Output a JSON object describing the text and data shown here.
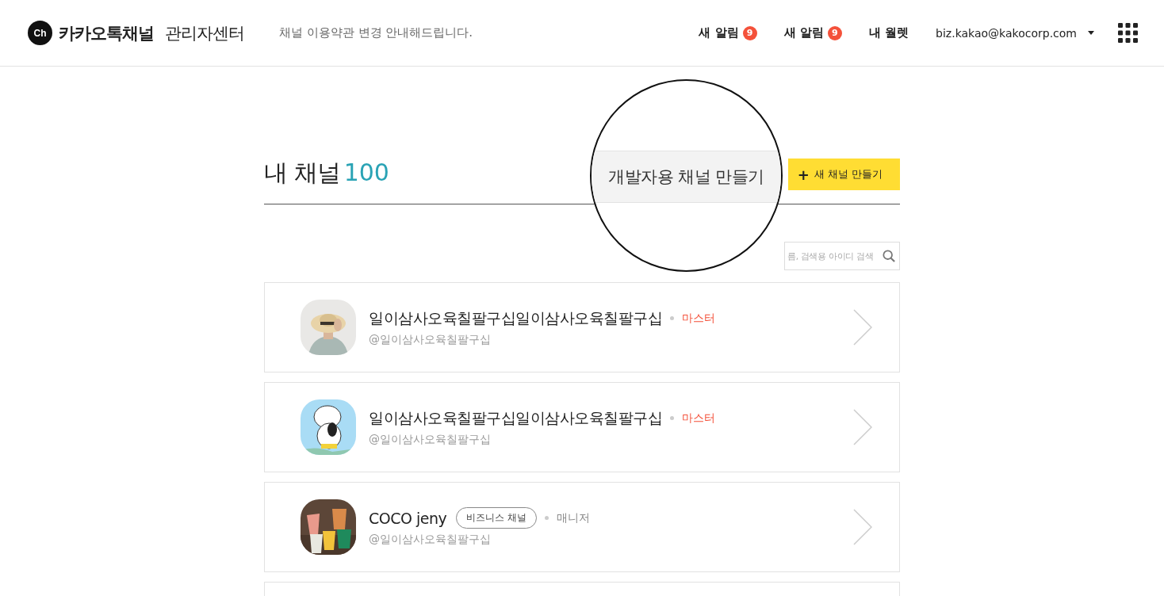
{
  "header": {
    "logo_mark": "Ch",
    "brand": "카카오톡채널",
    "brand_suffix": "관리자센터",
    "notice": "채널 이용약관 변경 안내해드립니다.",
    "nav": [
      {
        "label": "새 알림",
        "badge": "9"
      },
      {
        "label": "새 알림",
        "badge": "9"
      },
      {
        "label": "내 월렛"
      }
    ],
    "account": "biz.kakao@kakocorp.com"
  },
  "page": {
    "title": "내 채널",
    "count": "100",
    "magnified_button": "개발자용 채널 만들기",
    "new_button": {
      "icon": "+",
      "label": "새 채널 만들기"
    }
  },
  "search": {
    "placeholder": "름, 검색용 아이디 검색"
  },
  "channels": [
    {
      "name": "일이삼사오육칠팔구십일이삼사오육칠팔구십",
      "role": "마스터",
      "kind": "master",
      "handle": "@일이삼사오육칠팔구십"
    },
    {
      "name": "일이삼사오육칠팔구십일이삼사오육칠팔구십",
      "role": "마스터",
      "kind": "master",
      "handle": "@일이삼사오육칠팔구십"
    },
    {
      "name": "COCO jeny",
      "tag": "비즈니스 채널",
      "role": "매니저",
      "kind": "manager",
      "handle": "@일이삼사오육칠팔구십"
    }
  ]
}
